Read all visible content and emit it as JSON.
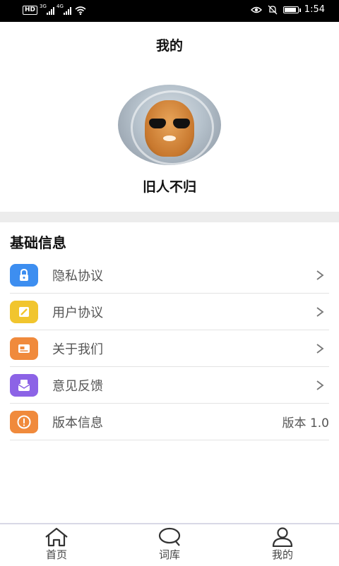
{
  "status_bar": {
    "left": "HD",
    "net1": "3G",
    "net2": "4G",
    "battery_level": 0.9,
    "time": "1:54"
  },
  "header": {
    "title": "我的"
  },
  "profile": {
    "username": "旧人不归"
  },
  "section": {
    "title": "基础信息"
  },
  "items": [
    {
      "label": "隐私协议",
      "icon": "lock-icon",
      "color": "#3d8ef0"
    },
    {
      "label": "用户协议",
      "icon": "edit-note-icon",
      "color": "#f1c52e"
    },
    {
      "label": "关于我们",
      "icon": "id-card-icon",
      "color": "#f08a3c"
    },
    {
      "label": "意见反馈",
      "icon": "feedback-mail-icon",
      "color": "#8c63e6"
    },
    {
      "label": "版本信息",
      "icon": "info-icon",
      "color": "#f08a3c",
      "value": "版本 1.0"
    }
  ],
  "tabs": [
    {
      "label": "首页",
      "icon": "home-icon"
    },
    {
      "label": "词库",
      "icon": "search-icon"
    },
    {
      "label": "我的",
      "icon": "user-icon"
    }
  ]
}
